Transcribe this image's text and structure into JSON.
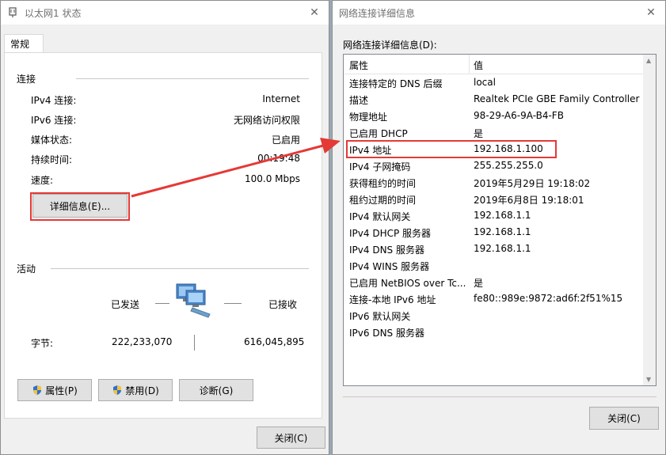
{
  "status_window": {
    "title": "以太网1 状态",
    "tab_general": "常规",
    "connection": {
      "header": "连接",
      "rows": [
        {
          "label": "IPv4 连接:",
          "value": "Internet"
        },
        {
          "label": "IPv6 连接:",
          "value": "无网络访问权限"
        },
        {
          "label": "媒体状态:",
          "value": "已启用"
        },
        {
          "label": "持续时间:",
          "value": "00:19:48"
        },
        {
          "label": "速度:",
          "value": "100.0 Mbps"
        }
      ],
      "details_button": "详细信息(E)..."
    },
    "activity": {
      "header": "活动",
      "sent_label": "已发送",
      "received_label": "已接收",
      "bytes_label": "字节:",
      "bytes_sent": "222,233,070",
      "bytes_received": "616,045,895"
    },
    "buttons": {
      "properties": "属性(P)",
      "disable": "禁用(D)",
      "diagnose": "诊断(G)",
      "close": "关闭(C)"
    }
  },
  "details_window": {
    "title": "网络连接详细信息",
    "list_label": "网络连接详细信息(D):",
    "col_property": "属性",
    "col_value": "值",
    "rows": [
      {
        "property": "连接特定的 DNS 后缀",
        "value": "local"
      },
      {
        "property": "描述",
        "value": "Realtek PCIe GBE Family Controller"
      },
      {
        "property": "物理地址",
        "value": "98-29-A6-9A-B4-FB"
      },
      {
        "property": "已启用 DHCP",
        "value": "是"
      },
      {
        "property": "IPv4 地址",
        "value": "192.168.1.100"
      },
      {
        "property": "IPv4 子网掩码",
        "value": "255.255.255.0"
      },
      {
        "property": "获得租约的时间",
        "value": "2019年5月29日 19:18:02"
      },
      {
        "property": "租约过期的时间",
        "value": "2019年6月8日 19:18:01"
      },
      {
        "property": "IPv4 默认网关",
        "value": "192.168.1.1"
      },
      {
        "property": "IPv4 DHCP 服务器",
        "value": "192.168.1.1"
      },
      {
        "property": "IPv4 DNS 服务器",
        "value": "192.168.1.1"
      },
      {
        "property": "IPv4 WINS 服务器",
        "value": ""
      },
      {
        "property": "已启用 NetBIOS over Tc...",
        "value": "是"
      },
      {
        "property": "连接-本地 IPv6 地址",
        "value": "fe80::989e:9872:ad6f:2f51%15"
      },
      {
        "property": "IPv6 默认网关",
        "value": ""
      },
      {
        "property": "IPv6 DNS 服务器",
        "value": ""
      }
    ],
    "close_button": "关闭(C)"
  },
  "colors": {
    "highlight_red": "#e53935"
  }
}
